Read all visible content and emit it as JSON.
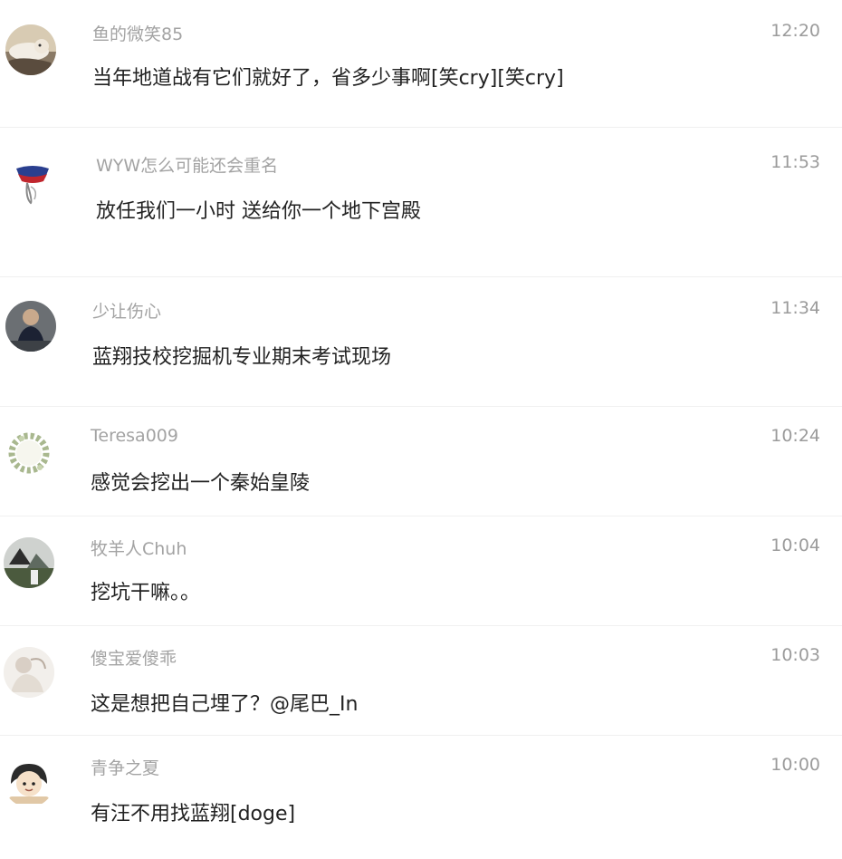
{
  "comments": [
    {
      "user": "鱼的微笑85",
      "time": "12:20",
      "text": "当年地道战有它们就好了，省多少事啊[笑cry][笑cry]",
      "avatar": "cat-lying-avatar"
    },
    {
      "user": "WYW怎么可能还会重名",
      "time": "11:53",
      "text": "放任我们一小时 送给你一个地下宫殿",
      "avatar": "doodle-figure-avatar"
    },
    {
      "user": "少让伤心",
      "time": "11:34",
      "text": "蓝翔技校挖掘机专业期末考试现场",
      "avatar": "dark-photo-avatar"
    },
    {
      "user": "Teresa009",
      "time": "10:24",
      "text": "感觉会挖出一个秦始皇陵",
      "avatar": "wreath-avatar"
    },
    {
      "user": "牧羊人Chuh",
      "time": "10:04",
      "text": "挖坑干嘛。。",
      "avatar": "landscape-avatar"
    },
    {
      "user": "傻宝爱傻乖",
      "time": "10:03",
      "text": "这是想把自己埋了？@尾巴_In",
      "avatar": "pale-sketch-avatar"
    },
    {
      "user": "青争之夏",
      "time": "10:00",
      "text": "有汪不用找蓝翔[doge]",
      "avatar": "cartoon-girl-avatar"
    }
  ],
  "colors": {
    "username": "#a3a3a3",
    "time": "#9b9b9b",
    "text": "#222222",
    "separator": "#f0f0f0"
  }
}
